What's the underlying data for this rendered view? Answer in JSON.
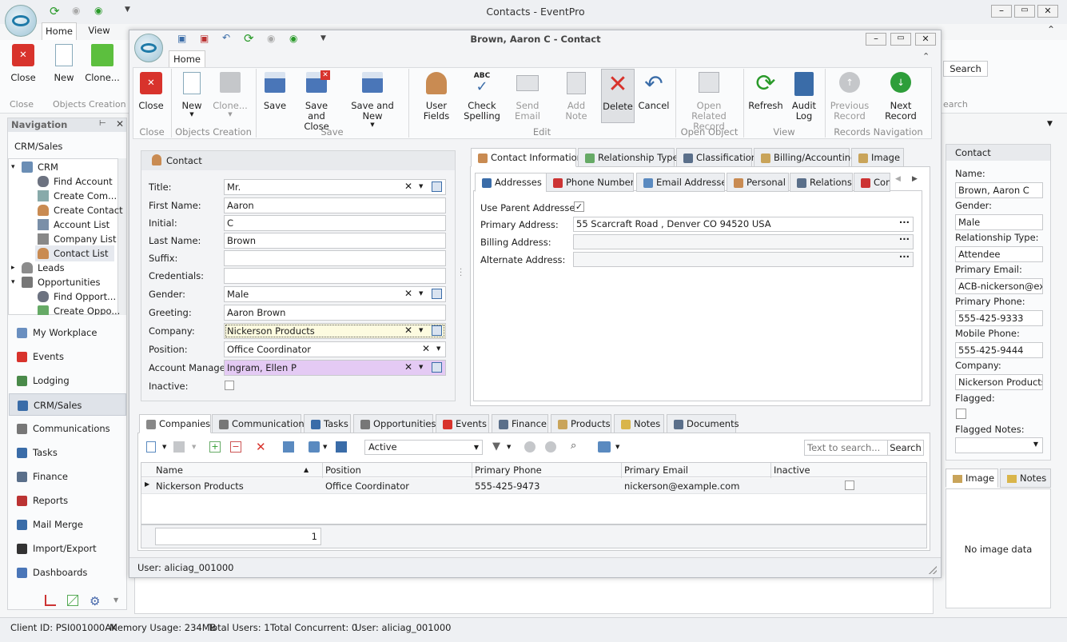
{
  "app": {
    "title": "Contacts - EventPro",
    "tabs": [
      "Home",
      "View"
    ]
  },
  "ribbon_bg": {
    "close_label": "Close",
    "new_label": "New",
    "clone_label": "Clone...",
    "group_close": "Close",
    "group_objects": "Objects Creation",
    "search_label": "Search",
    "search_partial": "earch"
  },
  "nav": {
    "title": "Navigation",
    "crm_sales": "CRM/Sales",
    "tree": [
      "CRM",
      "Find Account",
      "Create Com...",
      "Create Contact",
      "Account List",
      "Company List",
      "Contact List",
      "Leads",
      "Opportunities",
      "Find Opport...",
      "Create Oppo..."
    ],
    "modules": [
      "My Workplace",
      "Events",
      "Lodging",
      "CRM/Sales",
      "Communications",
      "Tasks",
      "Finance",
      "Reports",
      "Mail Merge",
      "Import/Export",
      "Dashboards"
    ]
  },
  "dialog": {
    "title": "Brown, Aaron C - Contact",
    "tab": "Home",
    "buttons": {
      "close": "Close",
      "new": "New",
      "clone": "Clone...",
      "save": "Save",
      "save_close": "Save and Close",
      "save_new": "Save and New",
      "user_fields": "User Fields",
      "check_spelling": "Check Spelling",
      "send_email": "Send Email",
      "add_note": "Add Note",
      "delete": "Delete",
      "cancel": "Cancel",
      "open_related": "Open Related Record",
      "refresh": "Refresh",
      "audit_log": "Audit Log",
      "previous_record": "Previous Record",
      "next_record": "Next Record"
    },
    "groups": {
      "close": "Close",
      "objects": "Objects Creation",
      "save": "Save",
      "edit": "Edit",
      "open_object": "Open Object",
      "view": "View",
      "records_nav": "Records Navigation"
    },
    "contact": {
      "header": "Contact",
      "labels": {
        "title": "Title:",
        "first_name": "First Name:",
        "initial": "Initial:",
        "last_name": "Last Name:",
        "suffix": "Suffix:",
        "credentials": "Credentials:",
        "gender": "Gender:",
        "greeting": "Greeting:",
        "company": "Company:",
        "position": "Position:",
        "account_manager": "Account Manager:",
        "inactive": "Inactive:"
      },
      "values": {
        "title": "Mr.",
        "first_name": "Aaron",
        "initial": "C",
        "last_name": "Brown",
        "suffix": "",
        "credentials": "",
        "gender": "Male",
        "greeting": "Aaron Brown",
        "company": "Nickerson Products",
        "position": "Office Coordinator",
        "account_manager": "Ingram, Ellen P"
      }
    },
    "info_tabs": [
      "Contact Information",
      "Relationship Type",
      "Classification",
      "Billing/Accounting",
      "Image"
    ],
    "sub_tabs": [
      "Addresses",
      "Phone Numbers",
      "Email Addresses",
      "Personal",
      "Relations",
      "Com"
    ],
    "address": {
      "use_parent": "Use Parent Addresses:",
      "primary_label": "Primary Address:",
      "primary_value": "55 Scarcraft Road , Denver CO 94520 USA",
      "billing_label": "Billing Address:",
      "alternate_label": "Alternate Address:"
    },
    "bottom_tabs": [
      "Companies",
      "Communications",
      "Tasks",
      "Opportunities",
      "Events",
      "Finance",
      "Products",
      "Notes",
      "Documents"
    ],
    "grid": {
      "filter": "Active",
      "search_placeholder": "Text to search...",
      "search_label": "Search",
      "columns": [
        "Name",
        "Position",
        "Primary Phone",
        "Primary Email",
        "Inactive"
      ],
      "rows": [
        {
          "name": "Nickerson Products",
          "position": "Office Coordinator",
          "phone": "555-425-9473",
          "email": "nickerson@example.com"
        }
      ],
      "count": "1"
    },
    "user_status": "User: aliciag_001000"
  },
  "right_panel": {
    "header": "Contact",
    "fields": [
      {
        "label": "Name:",
        "value": "Brown, Aaron C"
      },
      {
        "label": "Gender:",
        "value": "Male"
      },
      {
        "label": "Relationship Type:",
        "value": "Attendee"
      },
      {
        "label": "Primary Email:",
        "value": "ACB-nickerson@exam"
      },
      {
        "label": "Primary Phone:",
        "value": "555-425-9333"
      },
      {
        "label": "Mobile Phone:",
        "value": "555-425-9444"
      },
      {
        "label": "Company:",
        "value": "Nickerson Products"
      }
    ],
    "flagged": "Flagged:",
    "flagged_notes": "Flagged Notes:",
    "tabs": [
      "Image",
      "Notes"
    ],
    "no_image": "No image data"
  },
  "status": {
    "client": "Client ID: PSI001000AK",
    "memory": "Memory Usage: 234MB",
    "total_users": "Total Users: 1",
    "concurrent": "Total Concurrent: 0",
    "user": "User: aliciag_001000"
  }
}
